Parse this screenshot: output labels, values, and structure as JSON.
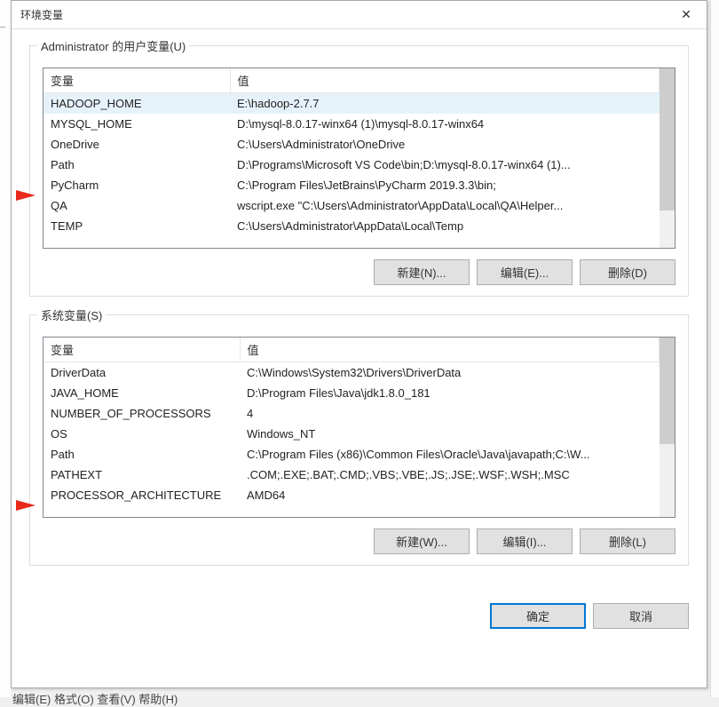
{
  "dialogTitle": "环境变量",
  "closeGlyph": "✕",
  "userSection": {
    "label": "Administrator 的用户变量(U)",
    "colVar": "变量",
    "colVal": "值",
    "rows": [
      {
        "name": "HADOOP_HOME",
        "value": "E:\\hadoop-2.7.7",
        "selected": true
      },
      {
        "name": "MYSQL_HOME",
        "value": "D:\\mysql-8.0.17-winx64 (1)\\mysql-8.0.17-winx64",
        "selected": false
      },
      {
        "name": "OneDrive",
        "value": "C:\\Users\\Administrator\\OneDrive",
        "selected": false
      },
      {
        "name": "Path",
        "value": "D:\\Programs\\Microsoft VS Code\\bin;D:\\mysql-8.0.17-winx64 (1)...",
        "selected": false
      },
      {
        "name": "PyCharm",
        "value": "C:\\Program Files\\JetBrains\\PyCharm 2019.3.3\\bin;",
        "selected": false
      },
      {
        "name": "QA",
        "value": "wscript.exe \"C:\\Users\\Administrator\\AppData\\Local\\QA\\Helper...",
        "selected": false
      },
      {
        "name": "TEMP",
        "value": "C:\\Users\\Administrator\\AppData\\Local\\Temp",
        "selected": false
      }
    ],
    "btnNew": "新建(N)...",
    "btnEdit": "编辑(E)...",
    "btnDelete": "删除(D)"
  },
  "sysSection": {
    "label": "系统变量(S)",
    "colVar": "变量",
    "colVal": "值",
    "rows": [
      {
        "name": "DriverData",
        "value": "C:\\Windows\\System32\\Drivers\\DriverData",
        "selected": false
      },
      {
        "name": "JAVA_HOME",
        "value": "D:\\Program Files\\Java\\jdk1.8.0_181",
        "selected": false
      },
      {
        "name": "NUMBER_OF_PROCESSORS",
        "value": "4",
        "selected": false
      },
      {
        "name": "OS",
        "value": "Windows_NT",
        "selected": false
      },
      {
        "name": "Path",
        "value": "C:\\Program Files (x86)\\Common Files\\Oracle\\Java\\javapath;C:\\W...",
        "selected": false
      },
      {
        "name": "PATHEXT",
        "value": ".COM;.EXE;.BAT;.CMD;.VBS;.VBE;.JS;.JSE;.WSF;.WSH;.MSC",
        "selected": false
      },
      {
        "name": "PROCESSOR_ARCHITECTURE",
        "value": "AMD64",
        "selected": false
      }
    ],
    "btnNew": "新建(W)...",
    "btnEdit": "编辑(I)...",
    "btnDelete": "删除(L)"
  },
  "footer": {
    "ok": "确定",
    "cancel": "取消"
  },
  "behindText": "编辑(E)   格式(O)   查看(V)   帮助(H)"
}
